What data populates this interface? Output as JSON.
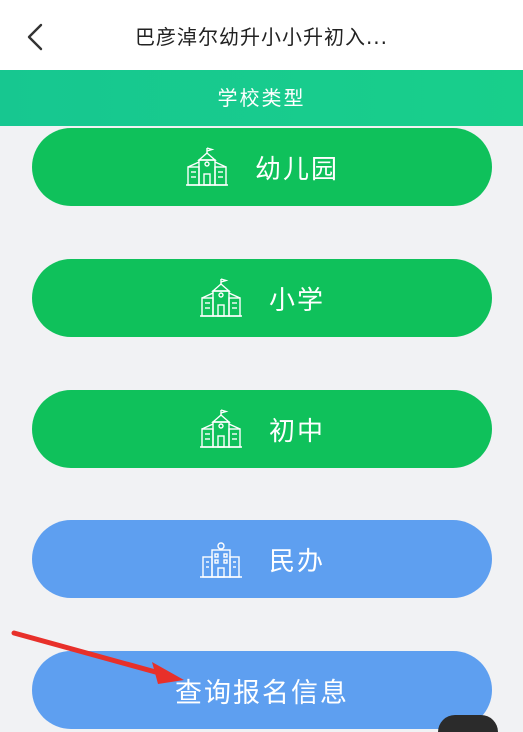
{
  "header": {
    "title": "巴彦淖尔幼升小小升初入..."
  },
  "section": {
    "title": "学校类型"
  },
  "school_types": [
    {
      "label": "幼儿园",
      "icon": "school-building-icon",
      "color": "#0fc15b"
    },
    {
      "label": "小学",
      "icon": "school-building-icon",
      "color": "#0fc15b"
    },
    {
      "label": "初中",
      "icon": "school-building-icon",
      "color": "#0fc15b"
    },
    {
      "label": "民办",
      "icon": "office-building-icon",
      "color": "#5e9ff0"
    }
  ],
  "query": {
    "label": "查询报名信息",
    "color": "#5e9ff0"
  },
  "colors": {
    "header_bg": "#17c790",
    "annotation_arrow": "#e8302a"
  }
}
